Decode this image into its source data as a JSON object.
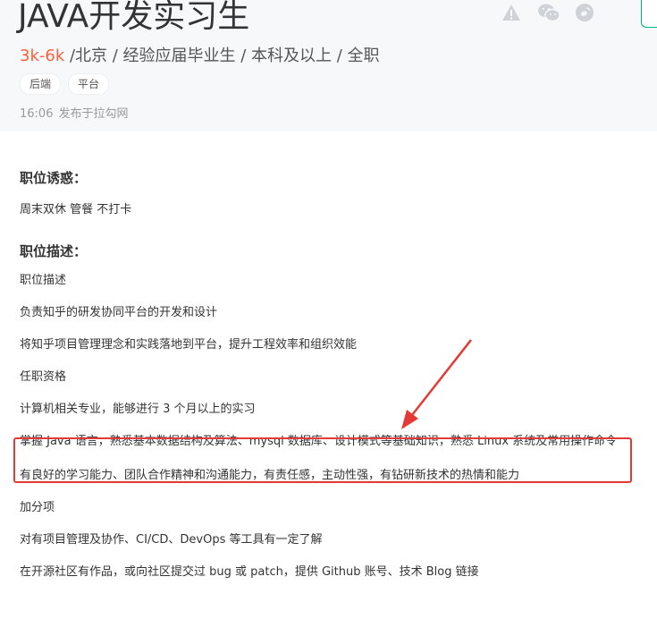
{
  "header": {
    "title": "JAVA开发实习生",
    "salary": "3k-6k",
    "meta_rest": " /北京 / 经验应届毕业生 / 本科及以上 / 全职",
    "tags": [
      "后端",
      "平台"
    ],
    "publish_time": "16:06",
    "publish_source": "发布于拉勾网",
    "icons": [
      "warning-icon",
      "wechat-icon",
      "weibo-icon"
    ]
  },
  "perks": {
    "title": "职位诱惑：",
    "text": "周末双休 管餐 不打卡"
  },
  "description": {
    "title": "职位描述：",
    "items": [
      "职位描述",
      "负责知乎的研发协同平台的开发和设计",
      "将知乎项目管理理念和实践落地到平台，提升工程效率和组织效能",
      "任职资格",
      "计算机相关专业，能够进行 3 个月以上的实习",
      "掌握 Java 语言，熟悉基本数据结构及算法、mysql 数据库、设计模式等基础知识，熟悉 Linux 系统及常用操作命令",
      "有良好的学习能力、团队合作精神和沟通能力，有责任感，主动性强，有钻研新技术的热情和能力",
      "加分项",
      "对有项目管理及协作、CI/CD、DevOps 等工具有一定了解",
      "在开源社区有作品，或向社区提交过 bug 或 patch，提供 Github 账号、技术 Blog 链接"
    ]
  },
  "colors": {
    "salary": "#fd5f39",
    "highlight": "#e53935",
    "header_bg": "#f7f8fa",
    "brand_green": "#00b38a"
  }
}
